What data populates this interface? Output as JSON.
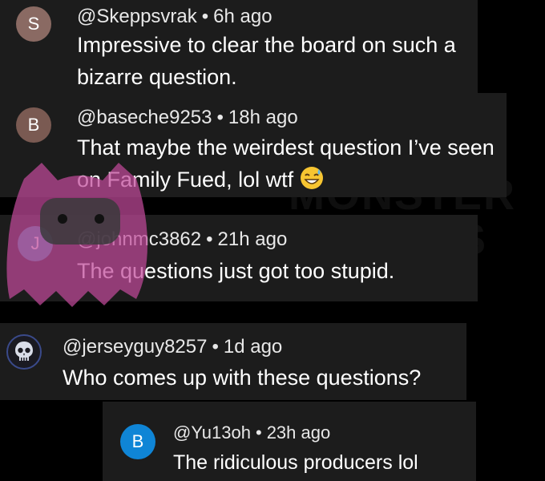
{
  "colors": {
    "background": "#000000",
    "card": "#1c1c1c",
    "text": "#ffffff",
    "meta": "#e8e8e8",
    "avatar_s": "#8a6a63",
    "avatar_b": "#7a5a52",
    "avatar_j": "#3a8ea6",
    "avatar_reply": "#0f85d6",
    "mascot": "#c04a9a"
  },
  "watermark": {
    "text": "MONSTER\nSCRIPTS",
    "logo": "mascot-logo"
  },
  "comments": [
    {
      "avatar_letter": "S",
      "handle": "@Skeppsvrak",
      "separator": "•",
      "time": "6h ago",
      "text_line1": "Impressive to clear the board on such a",
      "text_line2": "bizarre question."
    },
    {
      "avatar_letter": "B",
      "handle": "@baseche9253",
      "separator": "•",
      "time": "18h ago",
      "text_line1": "That maybe the weirdest question I’ve seen",
      "text_line2": "on Family Fued, lol wtf",
      "emoji": "grinning-sweat-emoji"
    },
    {
      "avatar_letter": "J",
      "handle": "@johnmc3862",
      "separator": "•",
      "time": "21h ago",
      "text": "The questions just got too stupid."
    },
    {
      "avatar_icon": "skull-shield-avatar",
      "handle": "@jerseyguy8257",
      "separator": "•",
      "time": "1d ago",
      "text": "Who comes up with these questions?"
    },
    {
      "avatar_letter": "B",
      "handle": "@Yu13oh",
      "separator": "•",
      "time": "23h ago",
      "text": "The ridiculous producers lol",
      "is_reply": true
    }
  ]
}
